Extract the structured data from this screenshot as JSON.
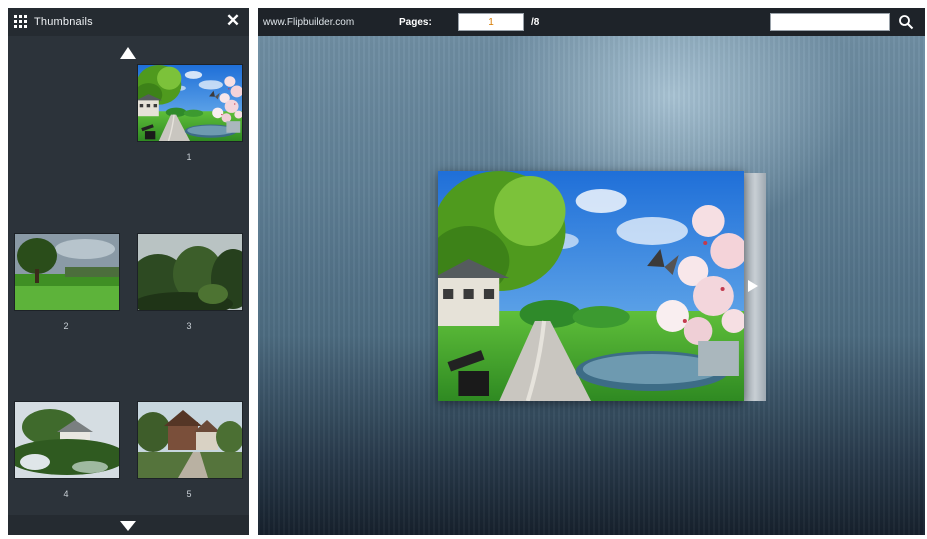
{
  "thumbnails_panel": {
    "title": "Thumbnails",
    "close_icon": "close-icon",
    "grid_icon": "grid-icon",
    "scroll_up_icon": "triangle-up-icon",
    "scroll_down_icon": "triangle-down-icon",
    "items": [
      {
        "label": "1",
        "scene": "park-spring"
      },
      {
        "label": "2",
        "scene": "meadow-tree"
      },
      {
        "label": "3",
        "scene": "forest"
      },
      {
        "label": "4",
        "scene": "garden-house"
      },
      {
        "label": "5",
        "scene": "village"
      }
    ]
  },
  "toolbar": {
    "site": "www.Flipbuilder.com",
    "pages_label": "Pages:",
    "page_value": "1",
    "page_total": "/8",
    "search_value": "",
    "search_icon": "magnifier-icon"
  },
  "viewer": {
    "page_image": "park-spring",
    "next_icon": "triangle-right-icon"
  },
  "colors": {
    "panel_bg": "#2c333a",
    "bar_bg": "#1e2329",
    "page_number": "#d67a00"
  }
}
